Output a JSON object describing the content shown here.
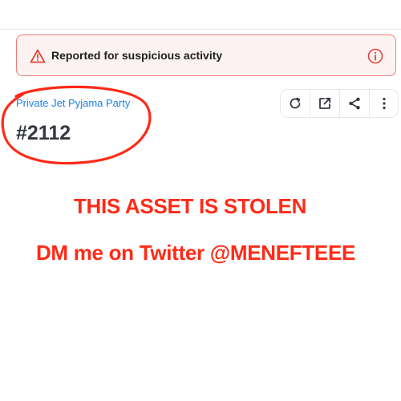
{
  "alert": {
    "message": "Reported for suspicious activity",
    "leading_icon": "warning-triangle-icon",
    "trailing_icon": "info-circle-icon",
    "border_color": "#f07a7a",
    "background": "#fdf2f2"
  },
  "item": {
    "collection_name": "Private Jet Pyjama Party",
    "token_title": "#2112"
  },
  "toolbar": {
    "icons": [
      "refresh-icon",
      "external-link-icon",
      "share-icon",
      "more-options-icon"
    ]
  },
  "overlay": {
    "line1": "THIS ASSET IS STOLEN",
    "line2": "DM me on Twitter @MENEFTEEE",
    "color": "#ff2a17"
  },
  "colors": {
    "link": "#2081e2",
    "title": "#353840",
    "annotation_circle": "#ff2a17"
  }
}
